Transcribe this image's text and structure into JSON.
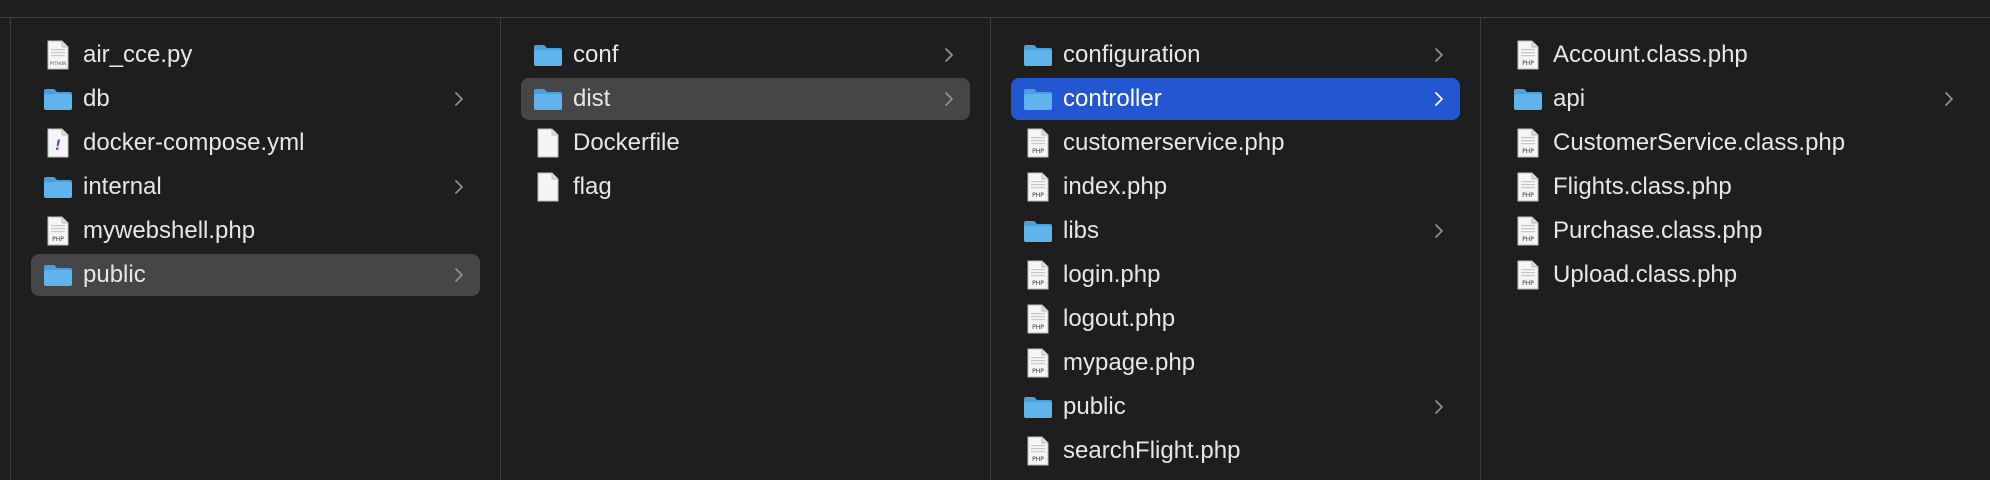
{
  "columns": [
    {
      "items": [
        {
          "name": "air_cce.py",
          "kind": "py",
          "folder": false,
          "selected": "none"
        },
        {
          "name": "db",
          "kind": "folder",
          "folder": true,
          "selected": "none"
        },
        {
          "name": "docker-compose.yml",
          "kind": "yml",
          "folder": false,
          "selected": "none"
        },
        {
          "name": "internal",
          "kind": "folder",
          "folder": true,
          "selected": "none"
        },
        {
          "name": "mywebshell.php",
          "kind": "php",
          "folder": false,
          "selected": "none"
        },
        {
          "name": "public",
          "kind": "folder",
          "folder": true,
          "selected": "grey"
        }
      ]
    },
    {
      "items": [
        {
          "name": "conf",
          "kind": "folder",
          "folder": true,
          "selected": "none"
        },
        {
          "name": "dist",
          "kind": "folder",
          "folder": true,
          "selected": "grey"
        },
        {
          "name": "Dockerfile",
          "kind": "blank",
          "folder": false,
          "selected": "none"
        },
        {
          "name": "flag",
          "kind": "blank",
          "folder": false,
          "selected": "none"
        }
      ]
    },
    {
      "items": [
        {
          "name": "configuration",
          "kind": "folder",
          "folder": true,
          "selected": "none"
        },
        {
          "name": "controller",
          "kind": "folder",
          "folder": true,
          "selected": "blue"
        },
        {
          "name": "customerservice.php",
          "kind": "php",
          "folder": false,
          "selected": "none"
        },
        {
          "name": "index.php",
          "kind": "php",
          "folder": false,
          "selected": "none"
        },
        {
          "name": "libs",
          "kind": "folder",
          "folder": true,
          "selected": "none"
        },
        {
          "name": "login.php",
          "kind": "php",
          "folder": false,
          "selected": "none"
        },
        {
          "name": "logout.php",
          "kind": "php",
          "folder": false,
          "selected": "none"
        },
        {
          "name": "mypage.php",
          "kind": "php",
          "folder": false,
          "selected": "none"
        },
        {
          "name": "public",
          "kind": "folder",
          "folder": true,
          "selected": "none"
        },
        {
          "name": "searchFlight.php",
          "kind": "php",
          "folder": false,
          "selected": "none"
        }
      ]
    },
    {
      "items": [
        {
          "name": "Account.class.php",
          "kind": "php",
          "folder": false,
          "selected": "none"
        },
        {
          "name": "api",
          "kind": "folder",
          "folder": true,
          "selected": "none"
        },
        {
          "name": "CustomerService.class.php",
          "kind": "php",
          "folder": false,
          "selected": "none"
        },
        {
          "name": "Flights.class.php",
          "kind": "php",
          "folder": false,
          "selected": "none"
        },
        {
          "name": "Purchase.class.php",
          "kind": "php",
          "folder": false,
          "selected": "none"
        },
        {
          "name": "Upload.class.php",
          "kind": "php",
          "folder": false,
          "selected": "none"
        }
      ]
    }
  ],
  "icon_labels": {
    "php": "PHP",
    "py": "PYTHON",
    "yml": "!"
  },
  "colors": {
    "folder_body": "#5fb4ec",
    "folder_tab": "#4a9fdc",
    "selection_blue": "#2357d1",
    "selection_grey": "#464649",
    "yml_mark": "#8a3fd1"
  }
}
